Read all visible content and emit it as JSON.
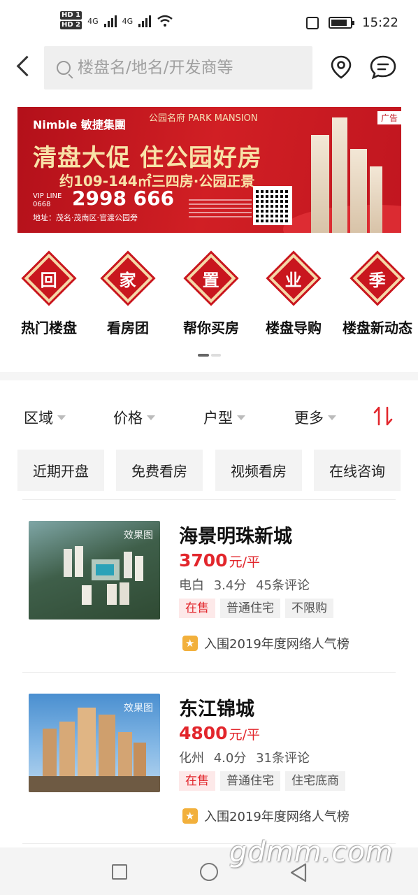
{
  "status_bar": {
    "hd1": "HD 1",
    "hd2": "HD 2",
    "net1": "4G",
    "net2": "4G",
    "time": "15:22"
  },
  "header": {
    "search_placeholder": "楼盘名/地名/开发商等"
  },
  "banner": {
    "ad_label": "广告",
    "brand": "Nimble 敏捷集團",
    "project": "公园名府 PARK MANSION",
    "headline": "清盘大促 住公园好房",
    "subline": "约109-144㎡三四房·公园正景",
    "hotline_tag": "VIP LINE 0668",
    "phone": "2998 666",
    "address": "地址：茂名·茂南区·官渡公园旁"
  },
  "categories": [
    {
      "glyph": "回",
      "label": "热门楼盘"
    },
    {
      "glyph": "家",
      "label": "看房团"
    },
    {
      "glyph": "置",
      "label": "帮你买房"
    },
    {
      "glyph": "业",
      "label": "楼盘导购"
    },
    {
      "glyph": "季",
      "label": "楼盘新动态"
    }
  ],
  "filters": [
    {
      "label": "区域"
    },
    {
      "label": "价格"
    },
    {
      "label": "户型"
    },
    {
      "label": "更多"
    }
  ],
  "quick_tags": [
    "近期开盘",
    "免费看房",
    "视频看房",
    "在线咨询"
  ],
  "listings": [
    {
      "image_label": "效果图",
      "name": "海景明珠新城",
      "price": "3700",
      "price_unit": "元/平",
      "district": "电白",
      "score": "3.4分",
      "reviews": "45条评论",
      "chips": [
        "在售",
        "普通住宅",
        "不限购"
      ],
      "rank": "入围2019年度网络人气榜"
    },
    {
      "image_label": "效果图",
      "name": "东江锦城",
      "price": "4800",
      "price_unit": "元/平",
      "district": "化州",
      "score": "4.0分",
      "reviews": "31条评论",
      "chips": [
        "在售",
        "普通住宅",
        "住宅底商"
      ],
      "rank": "入围2019年度网络人气榜"
    }
  ],
  "watermark": "gdmm.com",
  "colors": {
    "accent": "#e2262c",
    "banner_red": "#c9161e",
    "gold": "#f5d9a8",
    "star": "#f2b03c"
  }
}
